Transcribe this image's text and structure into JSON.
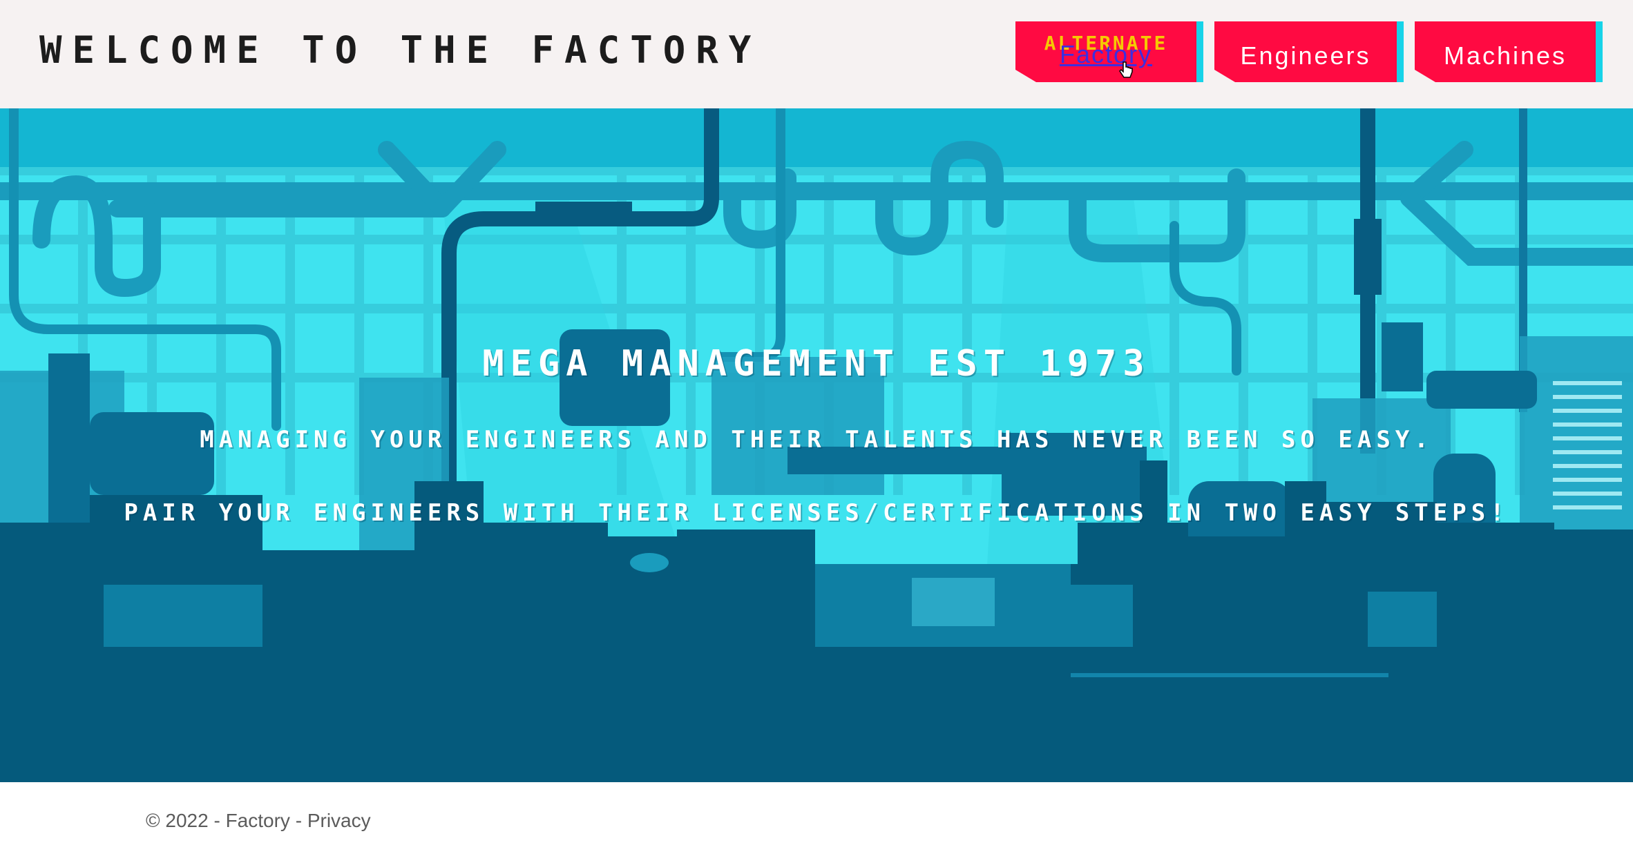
{
  "header": {
    "title": "WELCOME TO THE FACTORY",
    "nav": {
      "factory_overlay_text": "ALTERNATE",
      "factory_label": "Factory",
      "engineers_label": "Engineers",
      "machines_label": "Machines"
    }
  },
  "hero": {
    "heading": "MEGA MANAGEMENT EST 1973",
    "line1": "MANAGING YOUR ENGINEERS AND THEIR TALENTS HAS NEVER BEEN SO EASY.",
    "line2": "PAIR YOUR ENGINEERS WITH THEIR LICENSES/CERTIFICATIONS IN TWO EASY STEPS!"
  },
  "footer": {
    "copyright": "© 2022 - Factory - ",
    "privacy_label": "Privacy"
  },
  "colors": {
    "nav_button": "#ff0a42",
    "nav_accent": "#17d3e8",
    "hero_sky": "#3fe3ef",
    "hero_dark": "#055a7c"
  },
  "icons": [
    "mouse-pointer-icon"
  ]
}
